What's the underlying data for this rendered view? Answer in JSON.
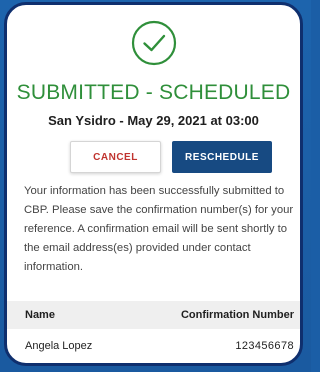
{
  "status": {
    "icon": "check-circle-icon",
    "title": "SUBMITTED - SCHEDULED",
    "subtitle": "San Ysidro - May 29, 2021 at 03:00",
    "color": "#2f8f3a"
  },
  "actions": {
    "cancel_label": "CANCEL",
    "reschedule_label": "RESCHEDULE",
    "cancel_color": "#c0342f",
    "reschedule_bg": "#174a82"
  },
  "message": "Your information has been successfully submitted to CBP. Please save the confirmation number(s) for your reference.  A confirmation email will be sent shortly to the email address(es) provided under contact information.",
  "table": {
    "columns": [
      "Name",
      "Confirmation Number"
    ],
    "rows": [
      {
        "name": "Angela Lopez",
        "confirmation_number": "123456678"
      }
    ]
  }
}
